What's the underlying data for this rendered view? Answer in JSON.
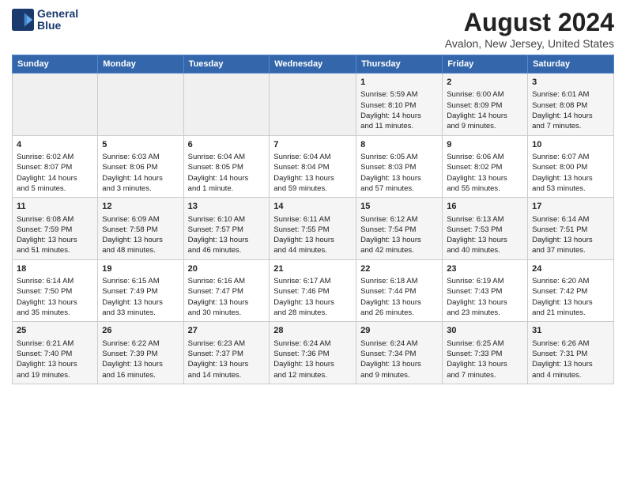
{
  "logo": {
    "line1": "General",
    "line2": "Blue"
  },
  "title": "August 2024",
  "subtitle": "Avalon, New Jersey, United States",
  "days_of_week": [
    "Sunday",
    "Monday",
    "Tuesday",
    "Wednesday",
    "Thursday",
    "Friday",
    "Saturday"
  ],
  "weeks": [
    [
      {
        "day": "",
        "info": ""
      },
      {
        "day": "",
        "info": ""
      },
      {
        "day": "",
        "info": ""
      },
      {
        "day": "",
        "info": ""
      },
      {
        "day": "1",
        "info": "Sunrise: 5:59 AM\nSunset: 8:10 PM\nDaylight: 14 hours\nand 11 minutes."
      },
      {
        "day": "2",
        "info": "Sunrise: 6:00 AM\nSunset: 8:09 PM\nDaylight: 14 hours\nand 9 minutes."
      },
      {
        "day": "3",
        "info": "Sunrise: 6:01 AM\nSunset: 8:08 PM\nDaylight: 14 hours\nand 7 minutes."
      }
    ],
    [
      {
        "day": "4",
        "info": "Sunrise: 6:02 AM\nSunset: 8:07 PM\nDaylight: 14 hours\nand 5 minutes."
      },
      {
        "day": "5",
        "info": "Sunrise: 6:03 AM\nSunset: 8:06 PM\nDaylight: 14 hours\nand 3 minutes."
      },
      {
        "day": "6",
        "info": "Sunrise: 6:04 AM\nSunset: 8:05 PM\nDaylight: 14 hours\nand 1 minute."
      },
      {
        "day": "7",
        "info": "Sunrise: 6:04 AM\nSunset: 8:04 PM\nDaylight: 13 hours\nand 59 minutes."
      },
      {
        "day": "8",
        "info": "Sunrise: 6:05 AM\nSunset: 8:03 PM\nDaylight: 13 hours\nand 57 minutes."
      },
      {
        "day": "9",
        "info": "Sunrise: 6:06 AM\nSunset: 8:02 PM\nDaylight: 13 hours\nand 55 minutes."
      },
      {
        "day": "10",
        "info": "Sunrise: 6:07 AM\nSunset: 8:00 PM\nDaylight: 13 hours\nand 53 minutes."
      }
    ],
    [
      {
        "day": "11",
        "info": "Sunrise: 6:08 AM\nSunset: 7:59 PM\nDaylight: 13 hours\nand 51 minutes."
      },
      {
        "day": "12",
        "info": "Sunrise: 6:09 AM\nSunset: 7:58 PM\nDaylight: 13 hours\nand 48 minutes."
      },
      {
        "day": "13",
        "info": "Sunrise: 6:10 AM\nSunset: 7:57 PM\nDaylight: 13 hours\nand 46 minutes."
      },
      {
        "day": "14",
        "info": "Sunrise: 6:11 AM\nSunset: 7:55 PM\nDaylight: 13 hours\nand 44 minutes."
      },
      {
        "day": "15",
        "info": "Sunrise: 6:12 AM\nSunset: 7:54 PM\nDaylight: 13 hours\nand 42 minutes."
      },
      {
        "day": "16",
        "info": "Sunrise: 6:13 AM\nSunset: 7:53 PM\nDaylight: 13 hours\nand 40 minutes."
      },
      {
        "day": "17",
        "info": "Sunrise: 6:14 AM\nSunset: 7:51 PM\nDaylight: 13 hours\nand 37 minutes."
      }
    ],
    [
      {
        "day": "18",
        "info": "Sunrise: 6:14 AM\nSunset: 7:50 PM\nDaylight: 13 hours\nand 35 minutes."
      },
      {
        "day": "19",
        "info": "Sunrise: 6:15 AM\nSunset: 7:49 PM\nDaylight: 13 hours\nand 33 minutes."
      },
      {
        "day": "20",
        "info": "Sunrise: 6:16 AM\nSunset: 7:47 PM\nDaylight: 13 hours\nand 30 minutes."
      },
      {
        "day": "21",
        "info": "Sunrise: 6:17 AM\nSunset: 7:46 PM\nDaylight: 13 hours\nand 28 minutes."
      },
      {
        "day": "22",
        "info": "Sunrise: 6:18 AM\nSunset: 7:44 PM\nDaylight: 13 hours\nand 26 minutes."
      },
      {
        "day": "23",
        "info": "Sunrise: 6:19 AM\nSunset: 7:43 PM\nDaylight: 13 hours\nand 23 minutes."
      },
      {
        "day": "24",
        "info": "Sunrise: 6:20 AM\nSunset: 7:42 PM\nDaylight: 13 hours\nand 21 minutes."
      }
    ],
    [
      {
        "day": "25",
        "info": "Sunrise: 6:21 AM\nSunset: 7:40 PM\nDaylight: 13 hours\nand 19 minutes."
      },
      {
        "day": "26",
        "info": "Sunrise: 6:22 AM\nSunset: 7:39 PM\nDaylight: 13 hours\nand 16 minutes."
      },
      {
        "day": "27",
        "info": "Sunrise: 6:23 AM\nSunset: 7:37 PM\nDaylight: 13 hours\nand 14 minutes."
      },
      {
        "day": "28",
        "info": "Sunrise: 6:24 AM\nSunset: 7:36 PM\nDaylight: 13 hours\nand 12 minutes."
      },
      {
        "day": "29",
        "info": "Sunrise: 6:24 AM\nSunset: 7:34 PM\nDaylight: 13 hours\nand 9 minutes."
      },
      {
        "day": "30",
        "info": "Sunrise: 6:25 AM\nSunset: 7:33 PM\nDaylight: 13 hours\nand 7 minutes."
      },
      {
        "day": "31",
        "info": "Sunrise: 6:26 AM\nSunset: 7:31 PM\nDaylight: 13 hours\nand 4 minutes."
      }
    ]
  ]
}
